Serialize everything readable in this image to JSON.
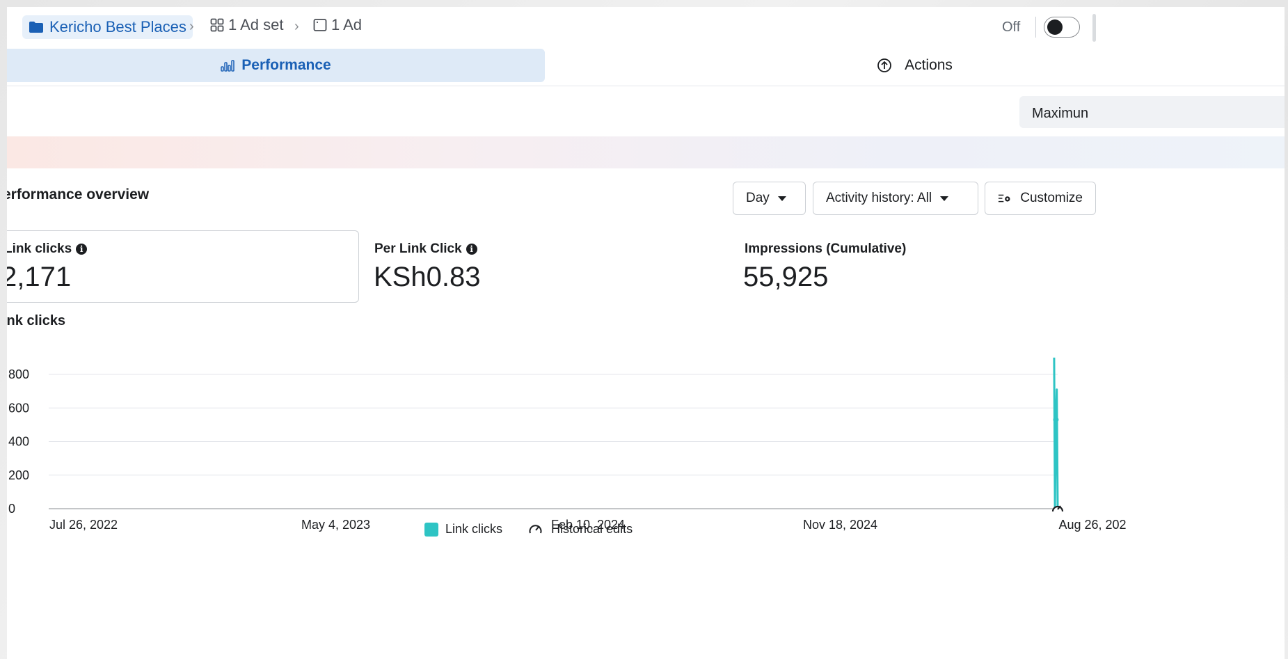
{
  "breadcrumb": {
    "campaign": "Kericho Best Places",
    "adset": "1 Ad set",
    "ad": "1 Ad"
  },
  "status": {
    "toggle_label": "Off",
    "toggle_on": false
  },
  "tabs": {
    "performance": "Performance",
    "actions": "Actions"
  },
  "maximize_label": "Maximun",
  "overview": {
    "title": "erformance overview",
    "day_label": "Day",
    "activity_label": "Activity history: All",
    "customize_label": "Customize"
  },
  "metrics": {
    "link_clicks_label": "Link clicks",
    "link_clicks_value": "2,171",
    "per_click_label": "Per Link Click",
    "per_click_value": "KSh0.83",
    "impressions_label": "Impressions (Cumulative)",
    "impressions_value": "55,925"
  },
  "chart_title": "ink clicks",
  "colors": {
    "accent": "#1a60b5",
    "series": "#2ec4c4",
    "tab_bg": "#deeaf7"
  },
  "chart_data": {
    "type": "line",
    "title": "ink clicks",
    "xlabel": "",
    "ylabel": "",
    "ylim": [
      0,
      800
    ],
    "yticks": [
      "800",
      "600",
      "400",
      "200",
      "0"
    ],
    "x_ticks": [
      "Jul 26, 2022",
      "May 4, 2023",
      "Feb 10, 2024",
      "Nov 18, 2024",
      "Aug 26, 202"
    ],
    "grid": true,
    "legend": "bottom",
    "series": [
      {
        "name": "Link clicks",
        "color": "#2ec4c4",
        "points": [
          {
            "x": "2025-08-22",
            "y": 900
          },
          {
            "x": "2025-08-23",
            "y": 0
          },
          {
            "x": "2025-08-24",
            "y": 530
          },
          {
            "x": "2025-08-25",
            "y": 710
          },
          {
            "x": "2025-08-26",
            "y": 0
          }
        ]
      }
    ],
    "historical_edits": [
      {
        "x": "2025-08-26"
      }
    ],
    "legend_items": [
      "Link clicks",
      "Historical edits"
    ]
  }
}
